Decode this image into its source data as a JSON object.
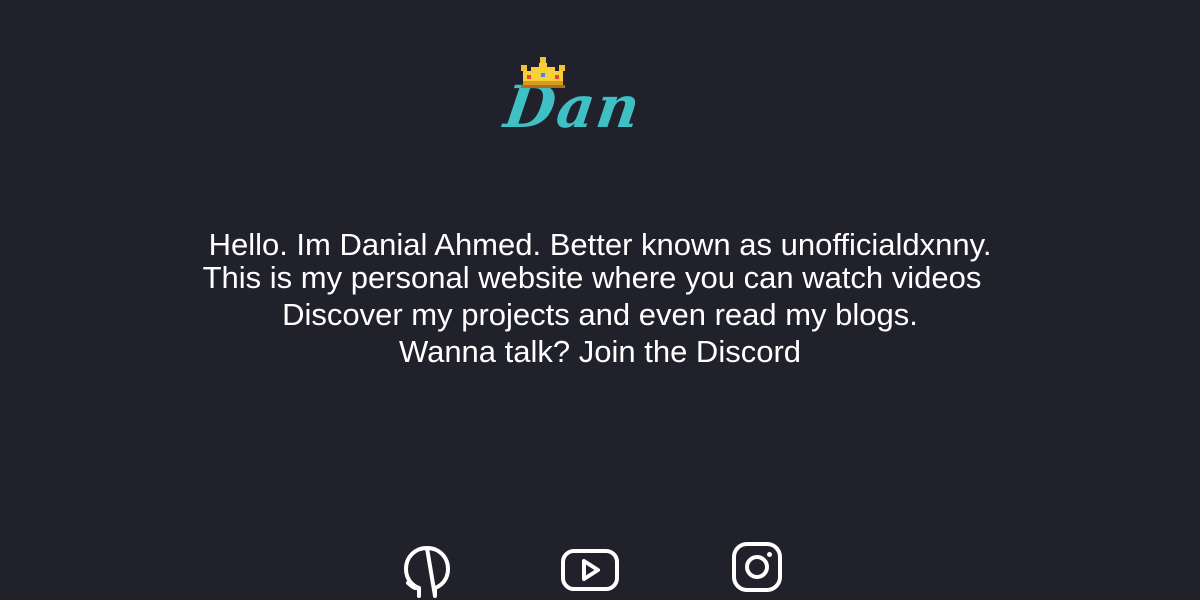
{
  "brand": {
    "logo_text": "Dan",
    "accent_color": "#3fc0c4",
    "crown_icon": "crown-icon"
  },
  "intro": {
    "lines": [
      "Hello. Im Danial Ahmed. Better known as unofficialdxnny.",
      "This is my personal website where you can watch videos",
      "Discover my projects and even read my blogs.",
      "Wanna talk? Join the Discord"
    ]
  },
  "socials": [
    {
      "icon": "github-icon"
    },
    {
      "icon": "youtube-icon"
    },
    {
      "icon": "instagram-icon"
    }
  ],
  "colors": {
    "background": "#20212b",
    "text": "#ffffff"
  }
}
